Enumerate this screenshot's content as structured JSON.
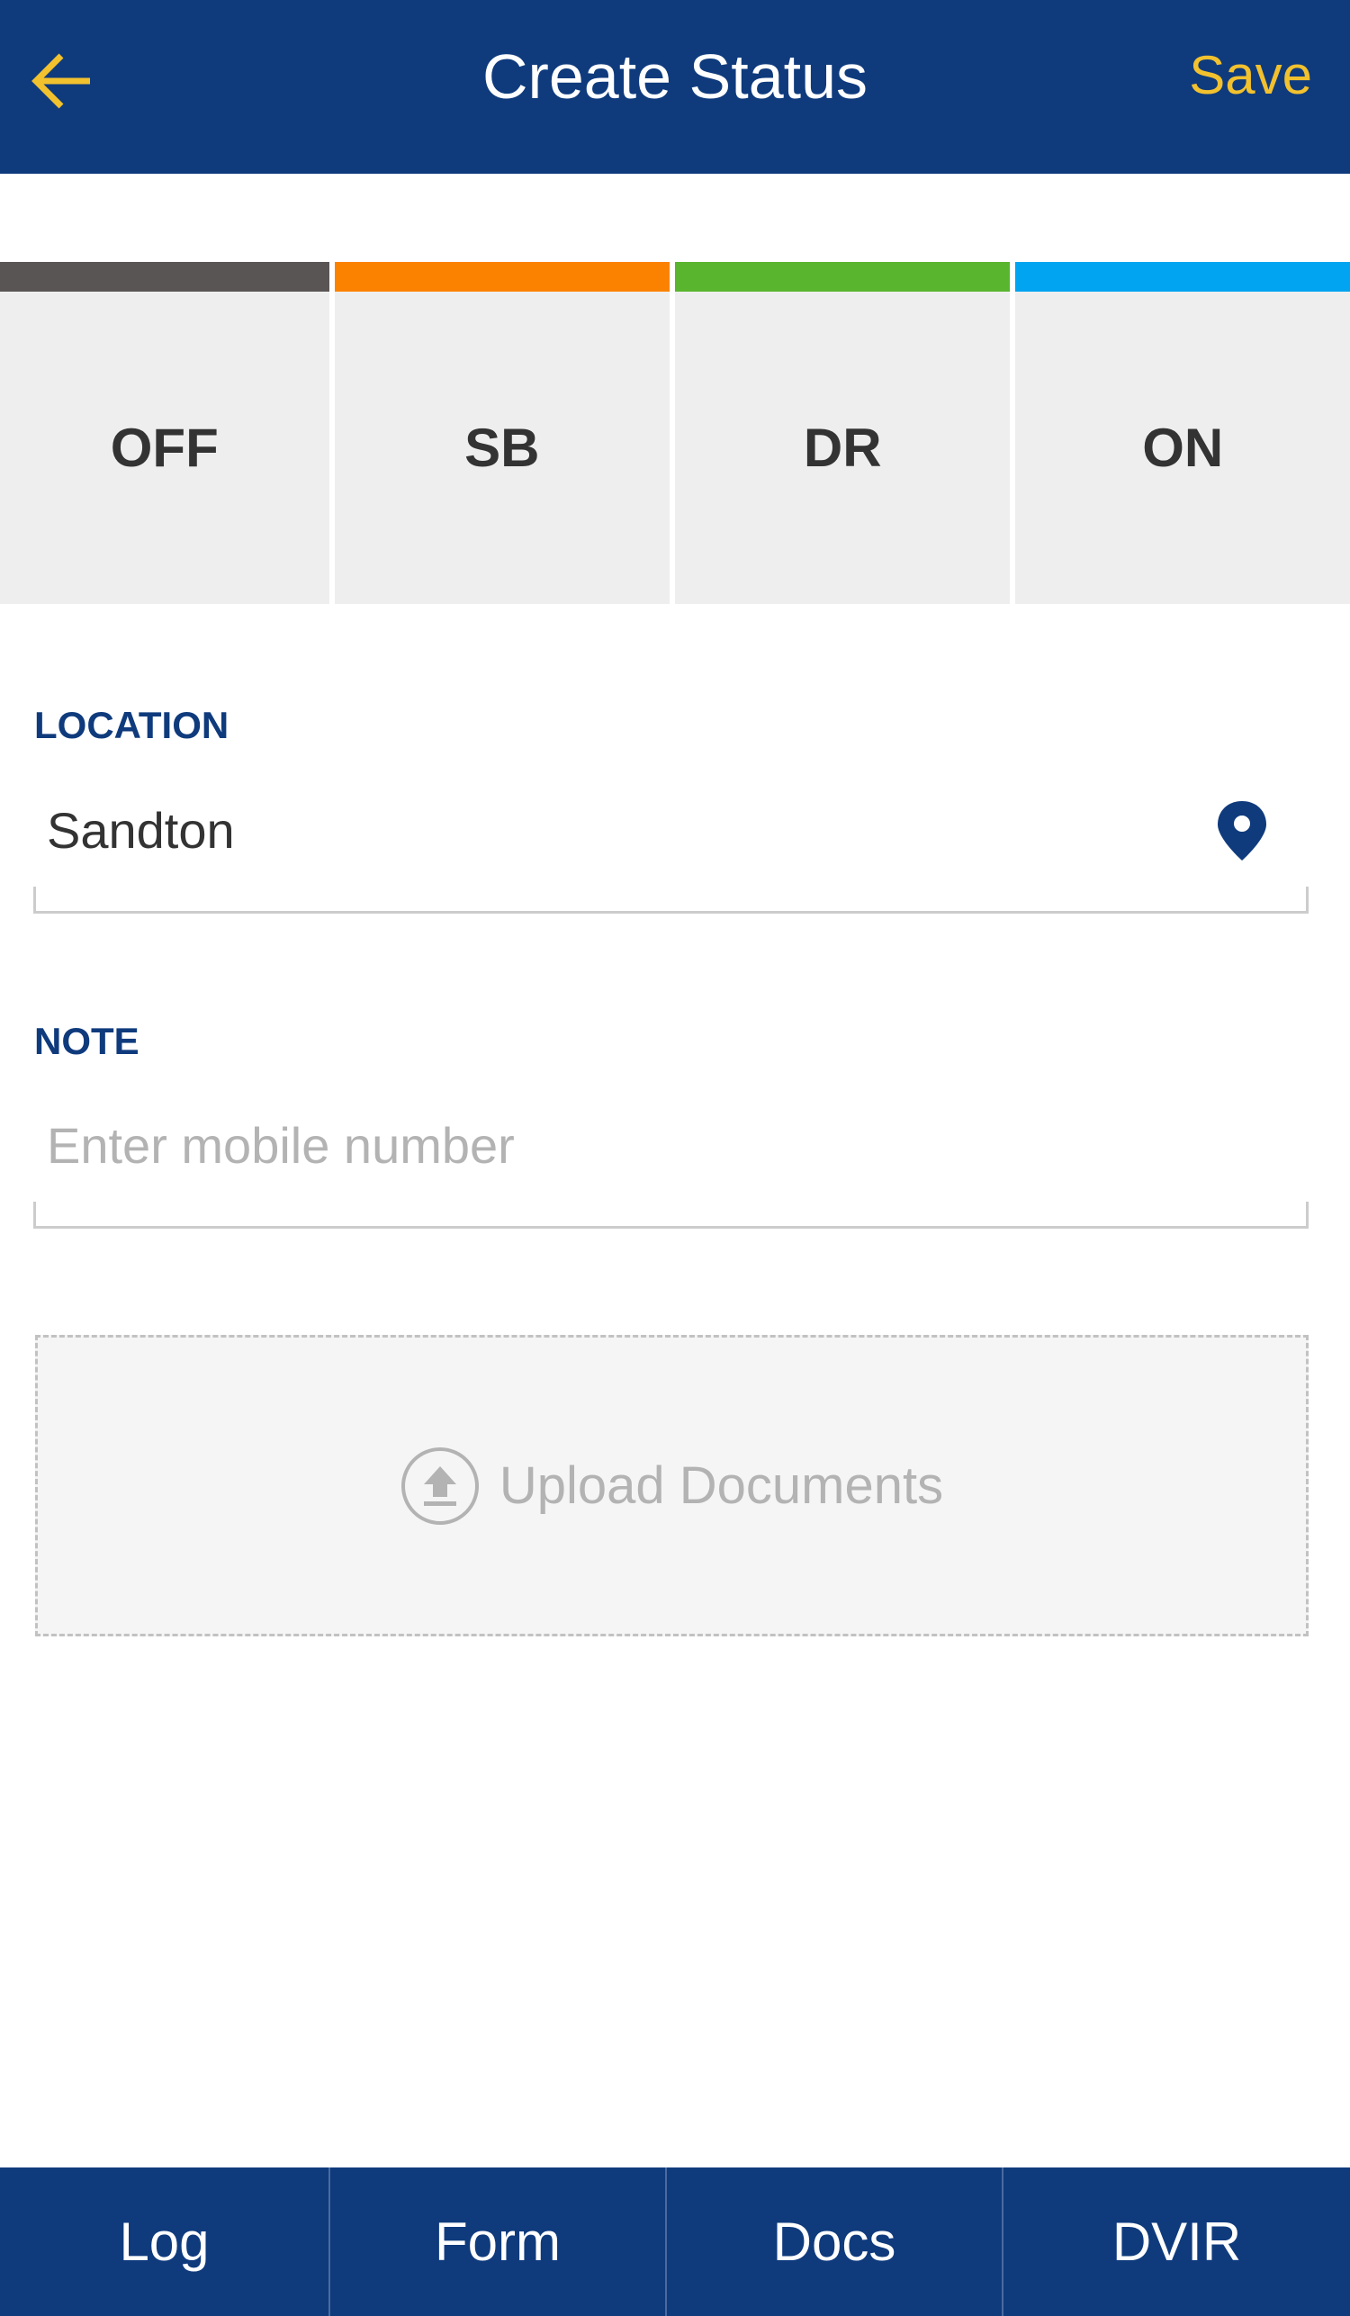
{
  "header": {
    "title": "Create Status",
    "save_label": "Save",
    "back_icon": "arrow-left-icon",
    "background_color": "#0f3b7d",
    "accent_color": "#f2c12e"
  },
  "status_tabs": [
    {
      "label": "OFF",
      "color": "#5a5555"
    },
    {
      "label": "SB",
      "color": "#fb8200"
    },
    {
      "label": "DR",
      "color": "#59b42e"
    },
    {
      "label": "ON",
      "color": "#00a4f0"
    }
  ],
  "location": {
    "label": "LOCATION",
    "value": "Sandton",
    "icon": "map-pin-icon"
  },
  "note": {
    "label": "NOTE",
    "placeholder": "Enter mobile number",
    "value": ""
  },
  "upload": {
    "label": "Upload Documents",
    "icon": "upload-icon"
  },
  "bottom_nav": [
    {
      "label": "Log"
    },
    {
      "label": "Form"
    },
    {
      "label": "Docs"
    },
    {
      "label": "DVIR"
    }
  ]
}
